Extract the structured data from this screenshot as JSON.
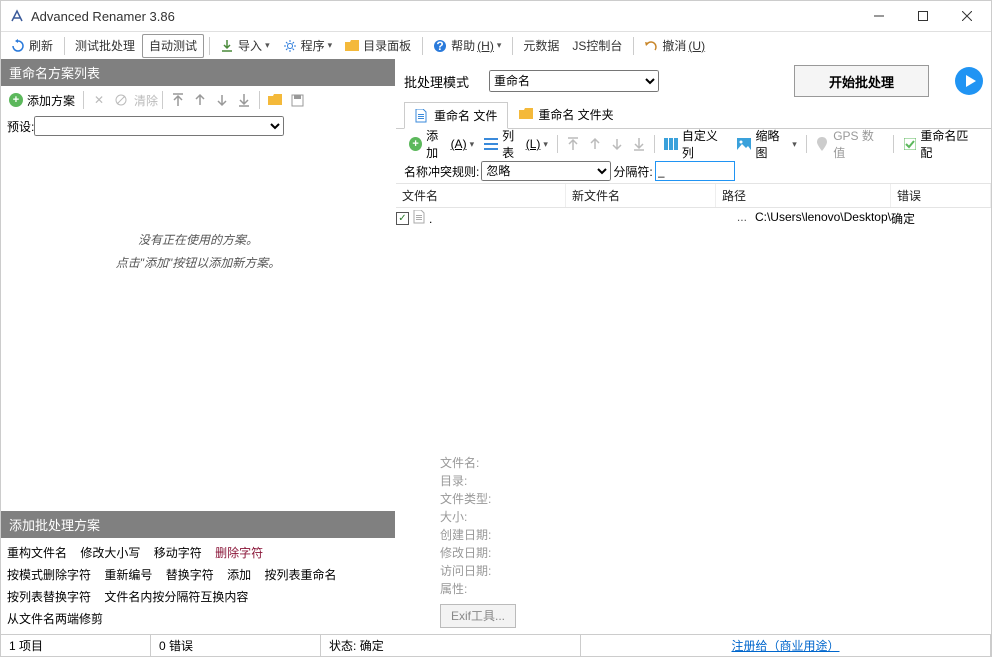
{
  "window": {
    "title": "Advanced Renamer 3.86"
  },
  "toolbar": {
    "refresh": "刷新",
    "testbatch": "测试批处理",
    "autotest": "自动测试",
    "import": "导入",
    "program": "程序",
    "dirpanel": "目录面板",
    "help": "帮助",
    "help_key": "(H)",
    "metadata": "元数据",
    "jsconsole": "JS控制台",
    "undo": "撤消",
    "undo_key": "(U)"
  },
  "left": {
    "title": "重命名方案列表",
    "add_scheme": "添加方案",
    "clear": "清除",
    "preset_label": "预设:",
    "empty1": "没有正在使用的方案。",
    "empty2": "点击\"添加\"按钮以添加新方案。",
    "panel2_title": "添加批处理方案",
    "schemes": {
      "a1": "重构文件名",
      "a2": "修改大小写",
      "a3": "移动字符",
      "a4": "删除字符",
      "b1": "按模式删除字符",
      "b2": "重新编号",
      "b3": "替换字符",
      "b4": "添加",
      "b5": "按列表重命名",
      "c1": "按列表替换字符",
      "c2": "文件名内按分隔符互换内容",
      "d1": "从文件名两端修剪"
    }
  },
  "right": {
    "mode_label": "批处理模式",
    "mode_value": "重命名",
    "start": "开始批处理",
    "tab_files": "重命名 文件",
    "tab_folders": "重命名 文件夹",
    "add": "添加",
    "add_key": "(A)",
    "list": "列表",
    "list_key": "(L)",
    "custom_cols": "自定义列",
    "thumbs": "缩略图",
    "gps": "GPS 数值",
    "rename_match": "重命名匹配",
    "conflict_label": "名称冲突规则:",
    "conflict_value": "忽略",
    "sep_label": "分隔符:",
    "sep_value": "_",
    "cols": {
      "c1": "文件名",
      "c2": "新文件名",
      "c3": "路径",
      "c4": "错误"
    },
    "row1": {
      "name": ".",
      "new": "",
      "dots": "...",
      "path": "C:\\Users\\lenovo\\Desktop\\",
      "err": "确定"
    },
    "info": {
      "l1": "文件名:",
      "l2": "目录:",
      "l3": "文件类型:",
      "l4": "大小:",
      "l5": "创建日期:",
      "l6": "修改日期:",
      "l7": "访问日期:",
      "l8": "属性:",
      "exif": "Exif工具..."
    }
  },
  "status": {
    "items": "1 项目",
    "errors": "0 错误",
    "state_label": "状态:",
    "state_val": "确定",
    "register": "注册给（商业用途）"
  }
}
